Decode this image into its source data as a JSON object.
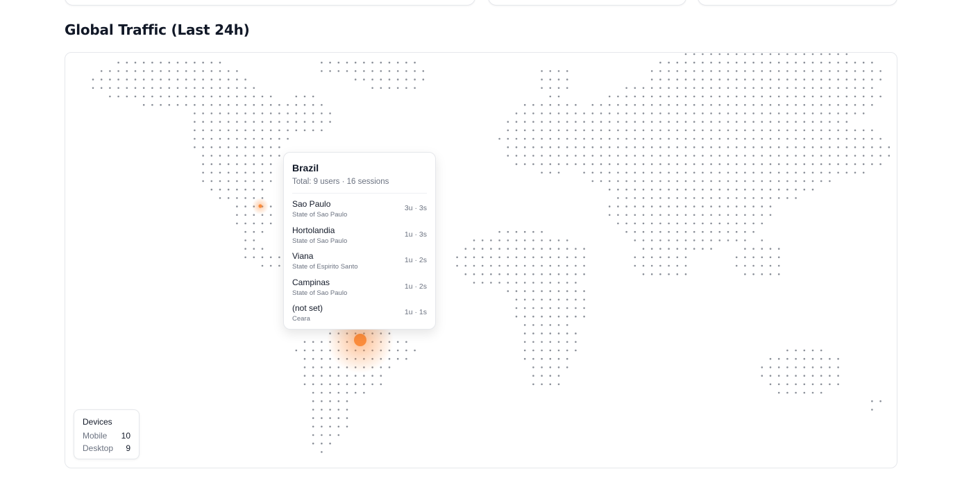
{
  "section": {
    "title": "Global Traffic (Last 24h)"
  },
  "tooltip": {
    "country": "Brazil",
    "total": "Total: 9 users · 16 sessions",
    "cities": [
      {
        "city": "Sao Paulo",
        "region": "State of Sao Paulo",
        "stats": "3u · 3s"
      },
      {
        "city": "Hortolandia",
        "region": "State of Sao Paulo",
        "stats": "1u · 3s"
      },
      {
        "city": "Viana",
        "region": "State of Espirito Santo",
        "stats": "1u · 2s"
      },
      {
        "city": "Campinas",
        "region": "State of Sao Paulo",
        "stats": "1u · 2s"
      },
      {
        "city": "(not set)",
        "region": "Ceara",
        "stats": "1u · 1s"
      }
    ]
  },
  "devices": {
    "title": "Devices",
    "items": [
      {
        "label": "Mobile",
        "value": "10"
      },
      {
        "label": "Desktop",
        "value": "9"
      }
    ]
  },
  "colors": {
    "dot": "#8a8f98",
    "highlight": "#fb8c3c"
  }
}
